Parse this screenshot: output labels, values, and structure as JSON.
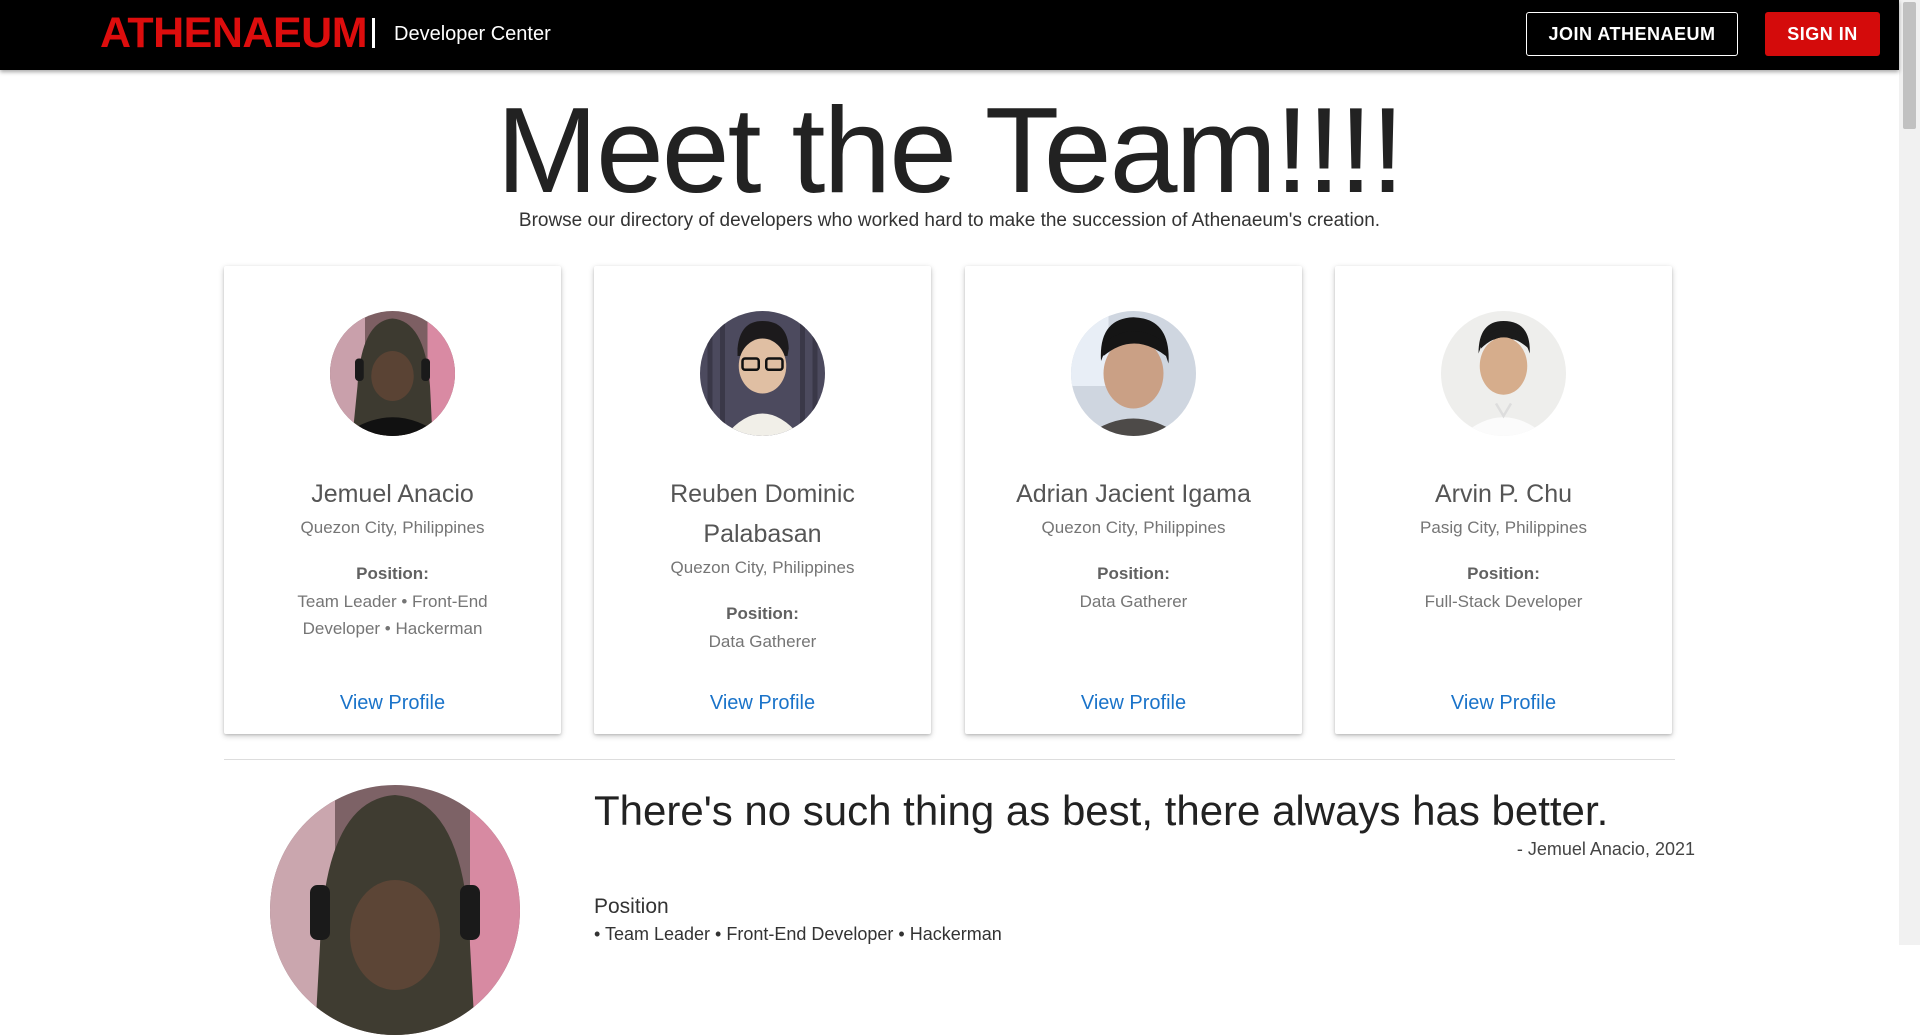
{
  "header": {
    "brand": "ATHENAEUM",
    "subtitle": "Developer Center",
    "join_label": "JOIN ATHENAEUM",
    "signin_label": "SIGN IN"
  },
  "hero": {
    "title": "Meet the Team!!!!",
    "subtitle": "Browse our directory of developers who worked hard to make the succession of Athenaeum's creation."
  },
  "cards": [
    {
      "name": "Jemuel Anacio",
      "location": "Quezon City, Philippines",
      "position_label": "Position:",
      "position": "Team Leader • Front-End Developer • Hackerman",
      "link": "View Profile"
    },
    {
      "name": "Reuben Dominic Palabasan",
      "location": "Quezon City, Philippines",
      "position_label": "Position:",
      "position": "Data Gatherer",
      "link": "View Profile"
    },
    {
      "name": "Adrian Jacient Igama",
      "location": "Quezon City, Philippines",
      "position_label": "Position:",
      "position": "Data Gatherer",
      "link": "View Profile"
    },
    {
      "name": "Arvin P. Chu",
      "location": "Pasig City, Philippines",
      "position_label": "Position:",
      "position": "Full-Stack Developer",
      "link": "View Profile"
    }
  ],
  "featured": {
    "quote": "There's no such thing as best, there always has better.",
    "attribution": "- Jemuel Anacio, 2021",
    "position_heading": "Position",
    "position_detail": "• Team Leader • Front-End Developer • Hackerman"
  },
  "colors": {
    "brand_red": "#dd0d0d",
    "signin_red": "#d40b0b",
    "link_blue": "#1a73c9",
    "topbar": "#000000"
  }
}
